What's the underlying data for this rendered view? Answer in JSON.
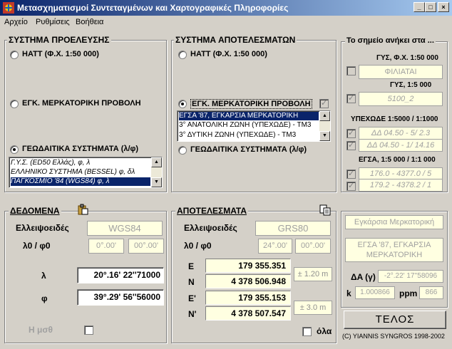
{
  "window": {
    "title": "Μετασχηματισμοί Συντεταγμένων και Χαρτογραφικές Πληροφορίες",
    "controls": [
      "_",
      "□",
      "×"
    ]
  },
  "menu": [
    "Αρχείο",
    "Ρυθμίσεις",
    "Βοήθεια"
  ],
  "source_system": {
    "title": "ΣΥΣΤΗΜΑ ΠΡΟΕΛΕΥΣΗΣ",
    "options": [
      "HATT (Φ.Χ. 1:50 000)",
      "ΕΓΚ. ΜΕΡΚΑΤΟΡΙΚΗ ΠΡΟΒΟΛΗ",
      "ΓΕΩΔΑΙΤΙΚΑ ΣΥΣΤΗΜΑΤΑ (λ/φ)"
    ],
    "selected_index": 2,
    "list": [
      "Γ.Υ.Σ. (ED50 Ελλάς), φ, λ",
      "ΕΛΛΗΝΙΚΟ ΣΥΣΤΗΜΑ (BESSEL) φ, δλ",
      "ΠΑΓΚΟΣΜΙΟ '84 (WGS84) φ, λ"
    ],
    "list_selected_index": 2
  },
  "target_system": {
    "title": "ΣΥΣΤΗΜΑ ΑΠΟΤΕΛΕΣΜΑΤΩΝ",
    "options": [
      "HATT (Φ.Χ. 1:50 000)",
      "ΕΓΚ. ΜΕΡΚΑΤΟΡΙΚΗ ΠΡΟΒΟΛΗ",
      "ΓΕΩΔΑΙΤΙΚΑ ΣΥΣΤΗΜΑΤΑ (λ/φ)"
    ],
    "selected_index": 1,
    "list": [
      "ΕΓΣΑ '87, ΕΓΚΑΡΣΙΑ ΜΕΡΚΑΤΟΡΙΚΗ",
      "3° ΑΝΑΤΟΛΙΚΗ ΖΩΝΗ (ΥΠΕΧΩΔΕ) - ΤΜ3",
      "3° ΔΥΤΙΚΗ ΖΩΝΗ (ΥΠΕΧΩΔΕ) - ΤΜ3"
    ],
    "list_selected_index": 0
  },
  "sheets": {
    "title": "Το σημείο ανήκει στα ...",
    "gys50_label": "ΓΥΣ, Φ.Χ. 1:50 000",
    "gys50_value": "ΦΙΛΙΑΤΑΙ",
    "gys5_label": "ΓΥΣ, 1:5 000",
    "gys5_value": "5100_2",
    "yp_label": "ΥΠΕΧΩΔΕ 1:5000 / 1:1000",
    "yp_value1": "ΔΔ 04.50 - 5/ 2.3",
    "yp_value2": "ΔΔ 04.50 - 1/ 14.16",
    "egsa_label": "ΕΓΣΑ, 1:5 000 / 1:1 000",
    "egsa_value1": "176.0 - 4377.0 / 5",
    "egsa_value2": "179.2 - 4378.2 / 1"
  },
  "input_data": {
    "title": "ΔΕΔΟΜΕΝΑ",
    "ellipsoid_label": "Ελλειψοειδές",
    "ellipsoid_value": "WGS84",
    "origin_label": "λ0 / φ0",
    "lambda0": "0°.00'",
    "phi0": "00°.00'",
    "lambda_label": "λ",
    "lambda_value": "20°.16' 22''71000",
    "phi_label": "φ",
    "phi_value": "39°.29' 56''56000",
    "h_label": "Η μσθ"
  },
  "results": {
    "title": "ΑΠΟΤΕΛΕΣΜΑΤΑ",
    "ellipsoid_label": "Ελλειψοειδές",
    "ellipsoid_value": "GRS80",
    "origin_label": "λ0 / φ0",
    "lambda0": "24°.00'",
    "phi0": "00°.00'",
    "E_label": "E",
    "E_value": "179 355.351",
    "N_label": "N",
    "N_value": "4 378 506.948",
    "acc1": "± 1.20 m",
    "E2_label": "E'",
    "E2_value": "179 355.153",
    "N2_label": "N'",
    "N2_value": "4 378 507.547",
    "acc2": "± 3.0 m",
    "all_label": "όλα"
  },
  "projection_info": {
    "name": "Εγκάρσια Μερκατορική",
    "system": "ΕΓΣΑ '87, ΕΓΚΑΡΣΙΑ ΜΕΡΚΑΤΟΡΙΚΗ",
    "dA_label": "ΔA (γ)",
    "dA_value": "-2°.22' 17''58096",
    "k_label": "k",
    "k_value": "1.000866",
    "ppm_label": "ppm",
    "ppm_value": "866"
  },
  "end_button": "ΤΕΛΟΣ",
  "copyright": "(C) YIANNIS SYNGROS 1998-2002"
}
